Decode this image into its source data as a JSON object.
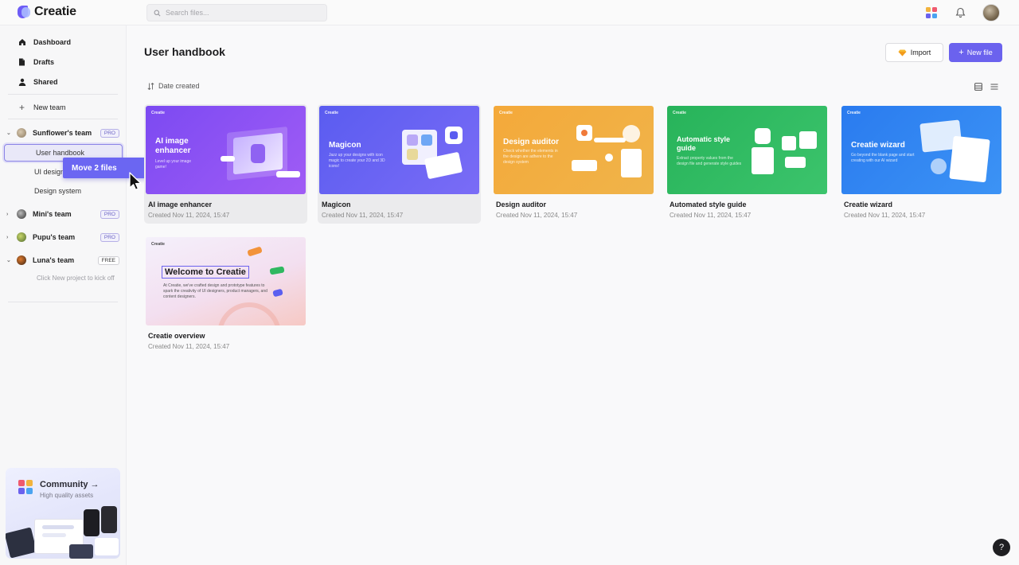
{
  "app": {
    "name": "Creatie"
  },
  "search": {
    "placeholder": "Search files..."
  },
  "sidebar": {
    "nav": [
      {
        "label": "Dashboard",
        "icon": "home-icon"
      },
      {
        "label": "Drafts",
        "icon": "file-icon"
      },
      {
        "label": "Shared",
        "icon": "user-icon"
      }
    ],
    "new_team": "New team",
    "teams": [
      {
        "name": "Sunflower's team",
        "badge": "PRO",
        "expanded": true,
        "projects": [
          "User handbook",
          "UI design",
          "Design system"
        ]
      },
      {
        "name": "Mini's team",
        "badge": "PRO",
        "expanded": false
      },
      {
        "name": "Pupu's team",
        "badge": "PRO",
        "expanded": false
      },
      {
        "name": "Luna's team",
        "badge": "FREE",
        "expanded": true
      }
    ],
    "hint": "Click New project to kick off",
    "community": {
      "title": "Community →",
      "subtitle": "High quality assets"
    }
  },
  "drag": {
    "label": "Move 2 files"
  },
  "main": {
    "title": "User handbook",
    "import_label": "Import",
    "new_file_label": "New file",
    "sort_label": "Date created",
    "files": [
      {
        "name": "AI image enhancer",
        "date": "Created Nov 11, 2024, 15:47",
        "thumb_title": "AI image enhancer",
        "thumb_desc": "Level up your image game!",
        "selected": true
      },
      {
        "name": "Magicon",
        "date": "Created Nov 11, 2024, 15:47",
        "thumb_title": "Magicon",
        "thumb_desc": "Jazz up your designs with icon magic to create your 2D and 3D icons!",
        "selected": true
      },
      {
        "name": "Design auditor",
        "date": "Created Nov 11, 2024, 15:47",
        "thumb_title": "Design auditor",
        "thumb_desc": "Check whether the elements in the design are adhere to the design system",
        "selected": false
      },
      {
        "name": "Automated style guide",
        "date": "Created Nov 11, 2024, 15:47",
        "thumb_title": "Automatic style guide",
        "thumb_desc": "Extract property values from the design file and generate style guides",
        "selected": false
      },
      {
        "name": "Creatie wizard",
        "date": "Created Nov 11, 2024, 15:47",
        "thumb_title": "Creatie wizard",
        "thumb_desc": "Go beyond the blank page and start creating with our AI wizard",
        "selected": false
      },
      {
        "name": "Creatie overview",
        "date": "Created Nov 11, 2024, 15:47",
        "thumb_title": "Welcome to Creatie",
        "thumb_desc": "At Creatie, we've crafted design and prototype features to spark the creativity of UI designers, product managers, and content designers.",
        "selected": false
      }
    ]
  },
  "help_label": "?",
  "colors": {
    "accent": "#6b62ee",
    "purple": "#8b5cf6",
    "indigo": "#5b5ff0",
    "orange": "#f2a93b",
    "green": "#2fb860",
    "blue": "#2f84f0"
  }
}
